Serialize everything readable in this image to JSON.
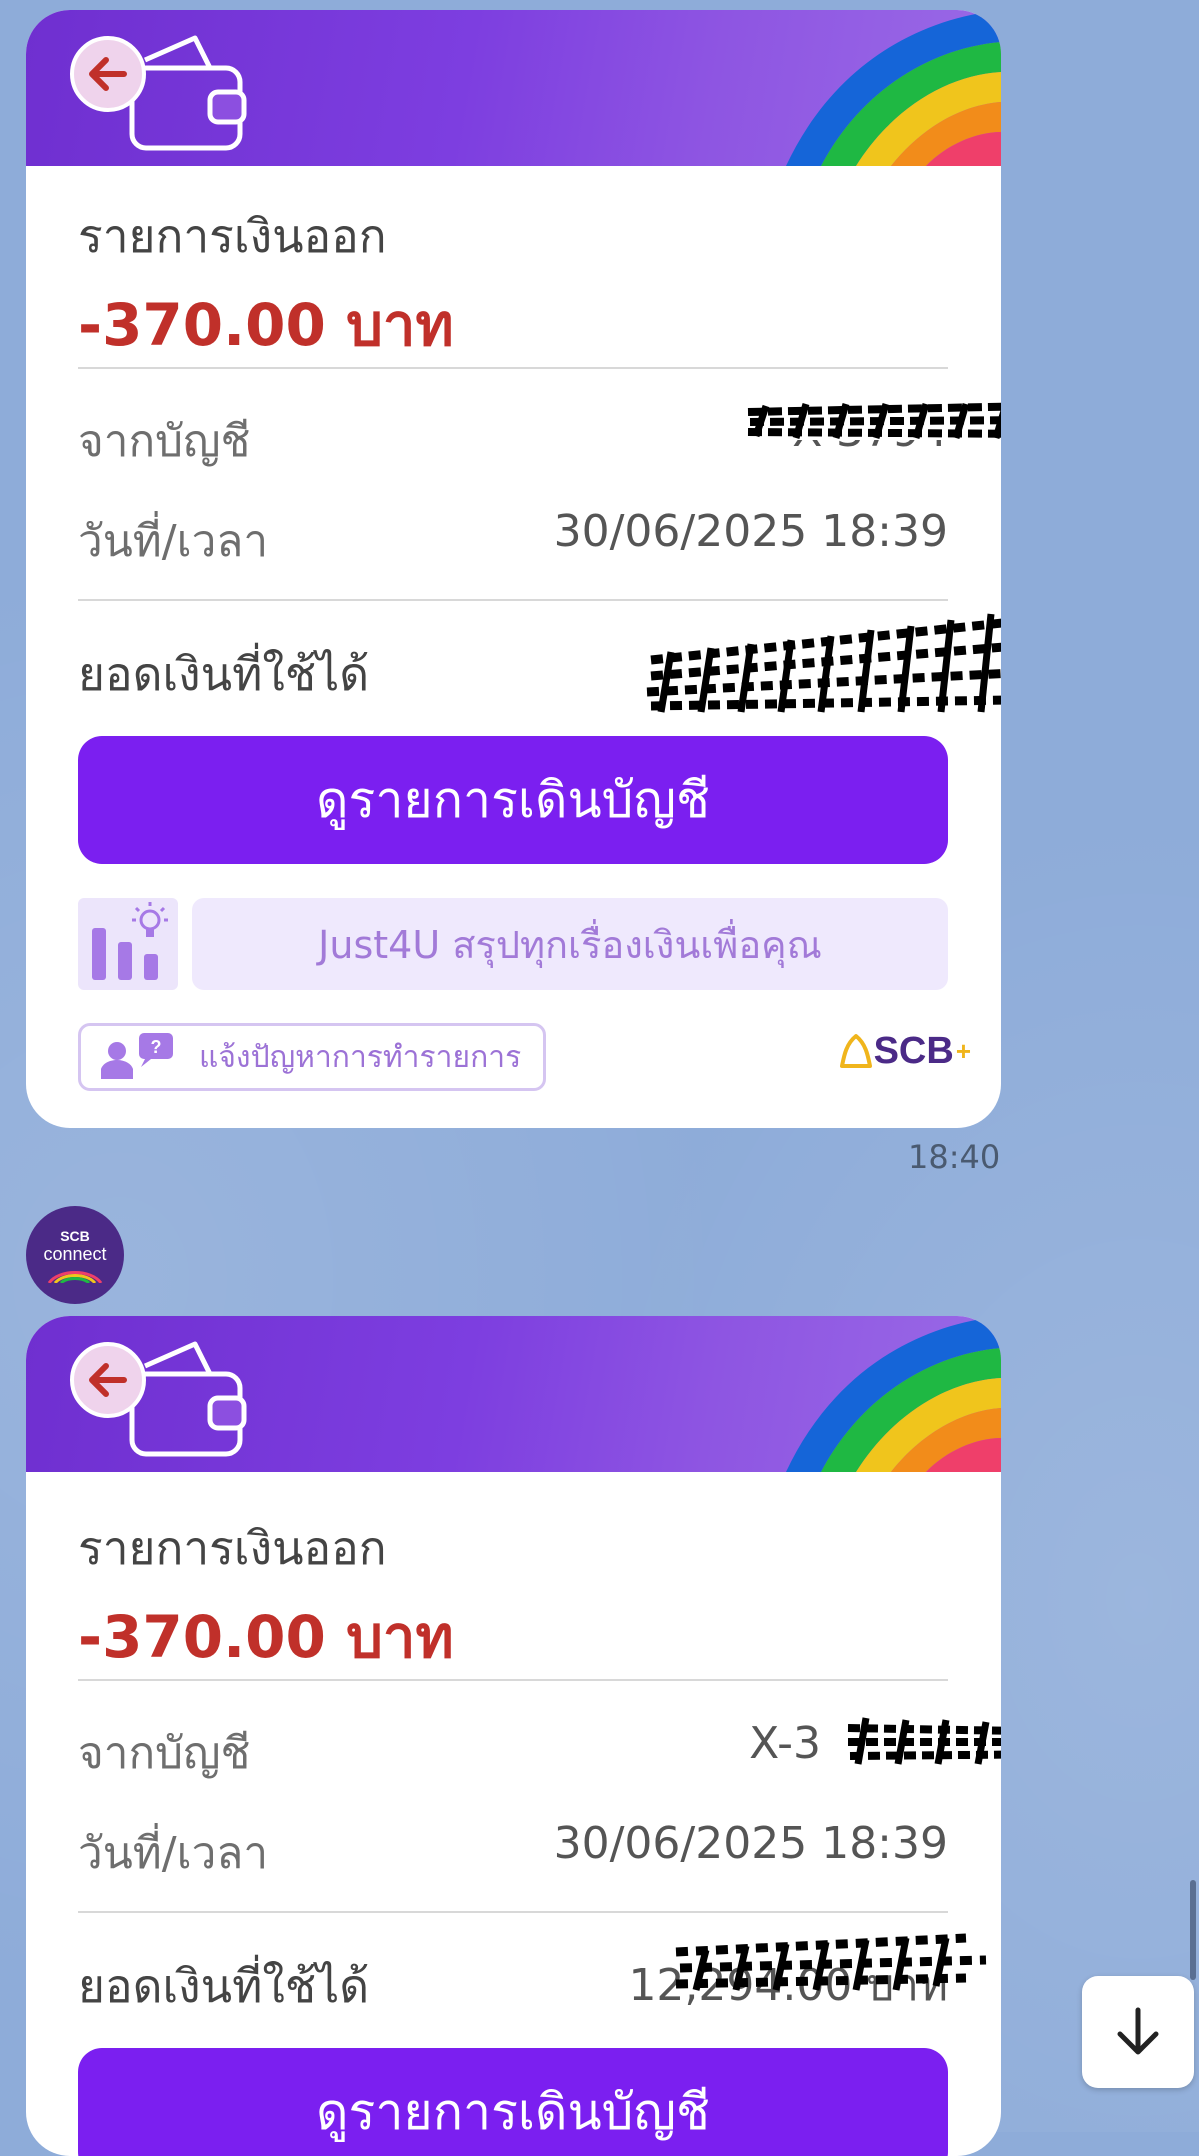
{
  "messages": [
    {
      "title": "รายการเงินออก",
      "amount": "-370.00 บาท",
      "from_account_label": "จากบัญชี",
      "from_account_value": "X-3794",
      "datetime_label": "วันที่/เวลา",
      "datetime_value": "30/06/2025 18:39",
      "balance_label": "ยอดเงินที่ใช้ได้",
      "balance_value": "1",
      "view_button": "ดูรายการเดินบัญชี",
      "just4u_text": "Just4U สรุปทุกเรื่องเงินเพื่อคุณ",
      "report_label": "แจ้งปัญหาการทำรายการ",
      "brand": "SCB",
      "time": "18:40"
    },
    {
      "title": "รายการเงินออก",
      "amount": "-370.00 บาท",
      "from_account_label": "จากบัญชี",
      "from_account_value": "X-3",
      "datetime_label": "วันที่/เวลา",
      "datetime_value": "30/06/2025 18:39",
      "balance_label": "ยอดเงินที่ใช้ได้",
      "balance_value": "12,294.00 บาท",
      "view_button": "ดูรายการเดินบัญชี"
    }
  ],
  "sender": {
    "avatar_line1": "SCB",
    "avatar_line2": "connect"
  },
  "colors": {
    "amount": "#c0302a",
    "button": "#7b1ff0",
    "banner": "#7d3ee0",
    "chat_background": "#8eacd9"
  }
}
